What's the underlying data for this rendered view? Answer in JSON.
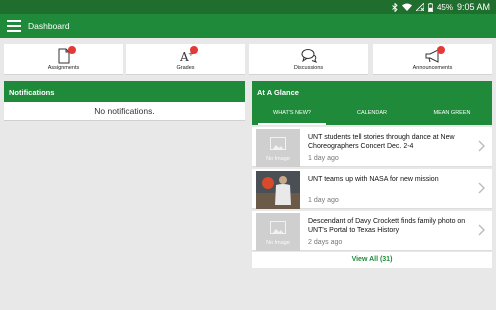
{
  "status": {
    "battery": "45%",
    "time": "9:05 AM"
  },
  "appbar": {
    "title": "Dashboard",
    "menu_icon": "hamburger-icon"
  },
  "tiles": [
    {
      "label": "Assignments",
      "icon": "assignment-icon",
      "badge": true
    },
    {
      "label": "Grades",
      "icon": "grades-icon",
      "badge": true
    },
    {
      "label": "Discussions",
      "icon": "discussions-icon",
      "badge": false
    },
    {
      "label": "Announcements",
      "icon": "announcement-icon",
      "badge": true
    }
  ],
  "notifications": {
    "title": "Notifications",
    "empty_text": "No notifications."
  },
  "glance": {
    "title": "At A Glance",
    "tabs": [
      {
        "label": "WHAT'S NEW?",
        "active": true
      },
      {
        "label": "CALENDAR",
        "active": false
      },
      {
        "label": "MEAN GREEN",
        "active": false
      }
    ],
    "items": [
      {
        "headline": "UNT students tell stories through dance at New Choreographers Concert Dec. 2-4",
        "age": "1 day ago",
        "thumb_text": "No Image",
        "has_image": false
      },
      {
        "headline": "UNT teams up with NASA for new mission",
        "age": "1 day ago",
        "thumb_text": "",
        "has_image": true
      },
      {
        "headline": "Descendant of Davy Crockett finds family photo on UNT's Portal to Texas History",
        "age": "2 days ago",
        "thumb_text": "No Image",
        "has_image": false
      }
    ],
    "view_all": "View All (31)"
  },
  "colors": {
    "primary": "#1f8a3a",
    "status_bar": "#1f6e2e",
    "badge": "#e53935"
  }
}
